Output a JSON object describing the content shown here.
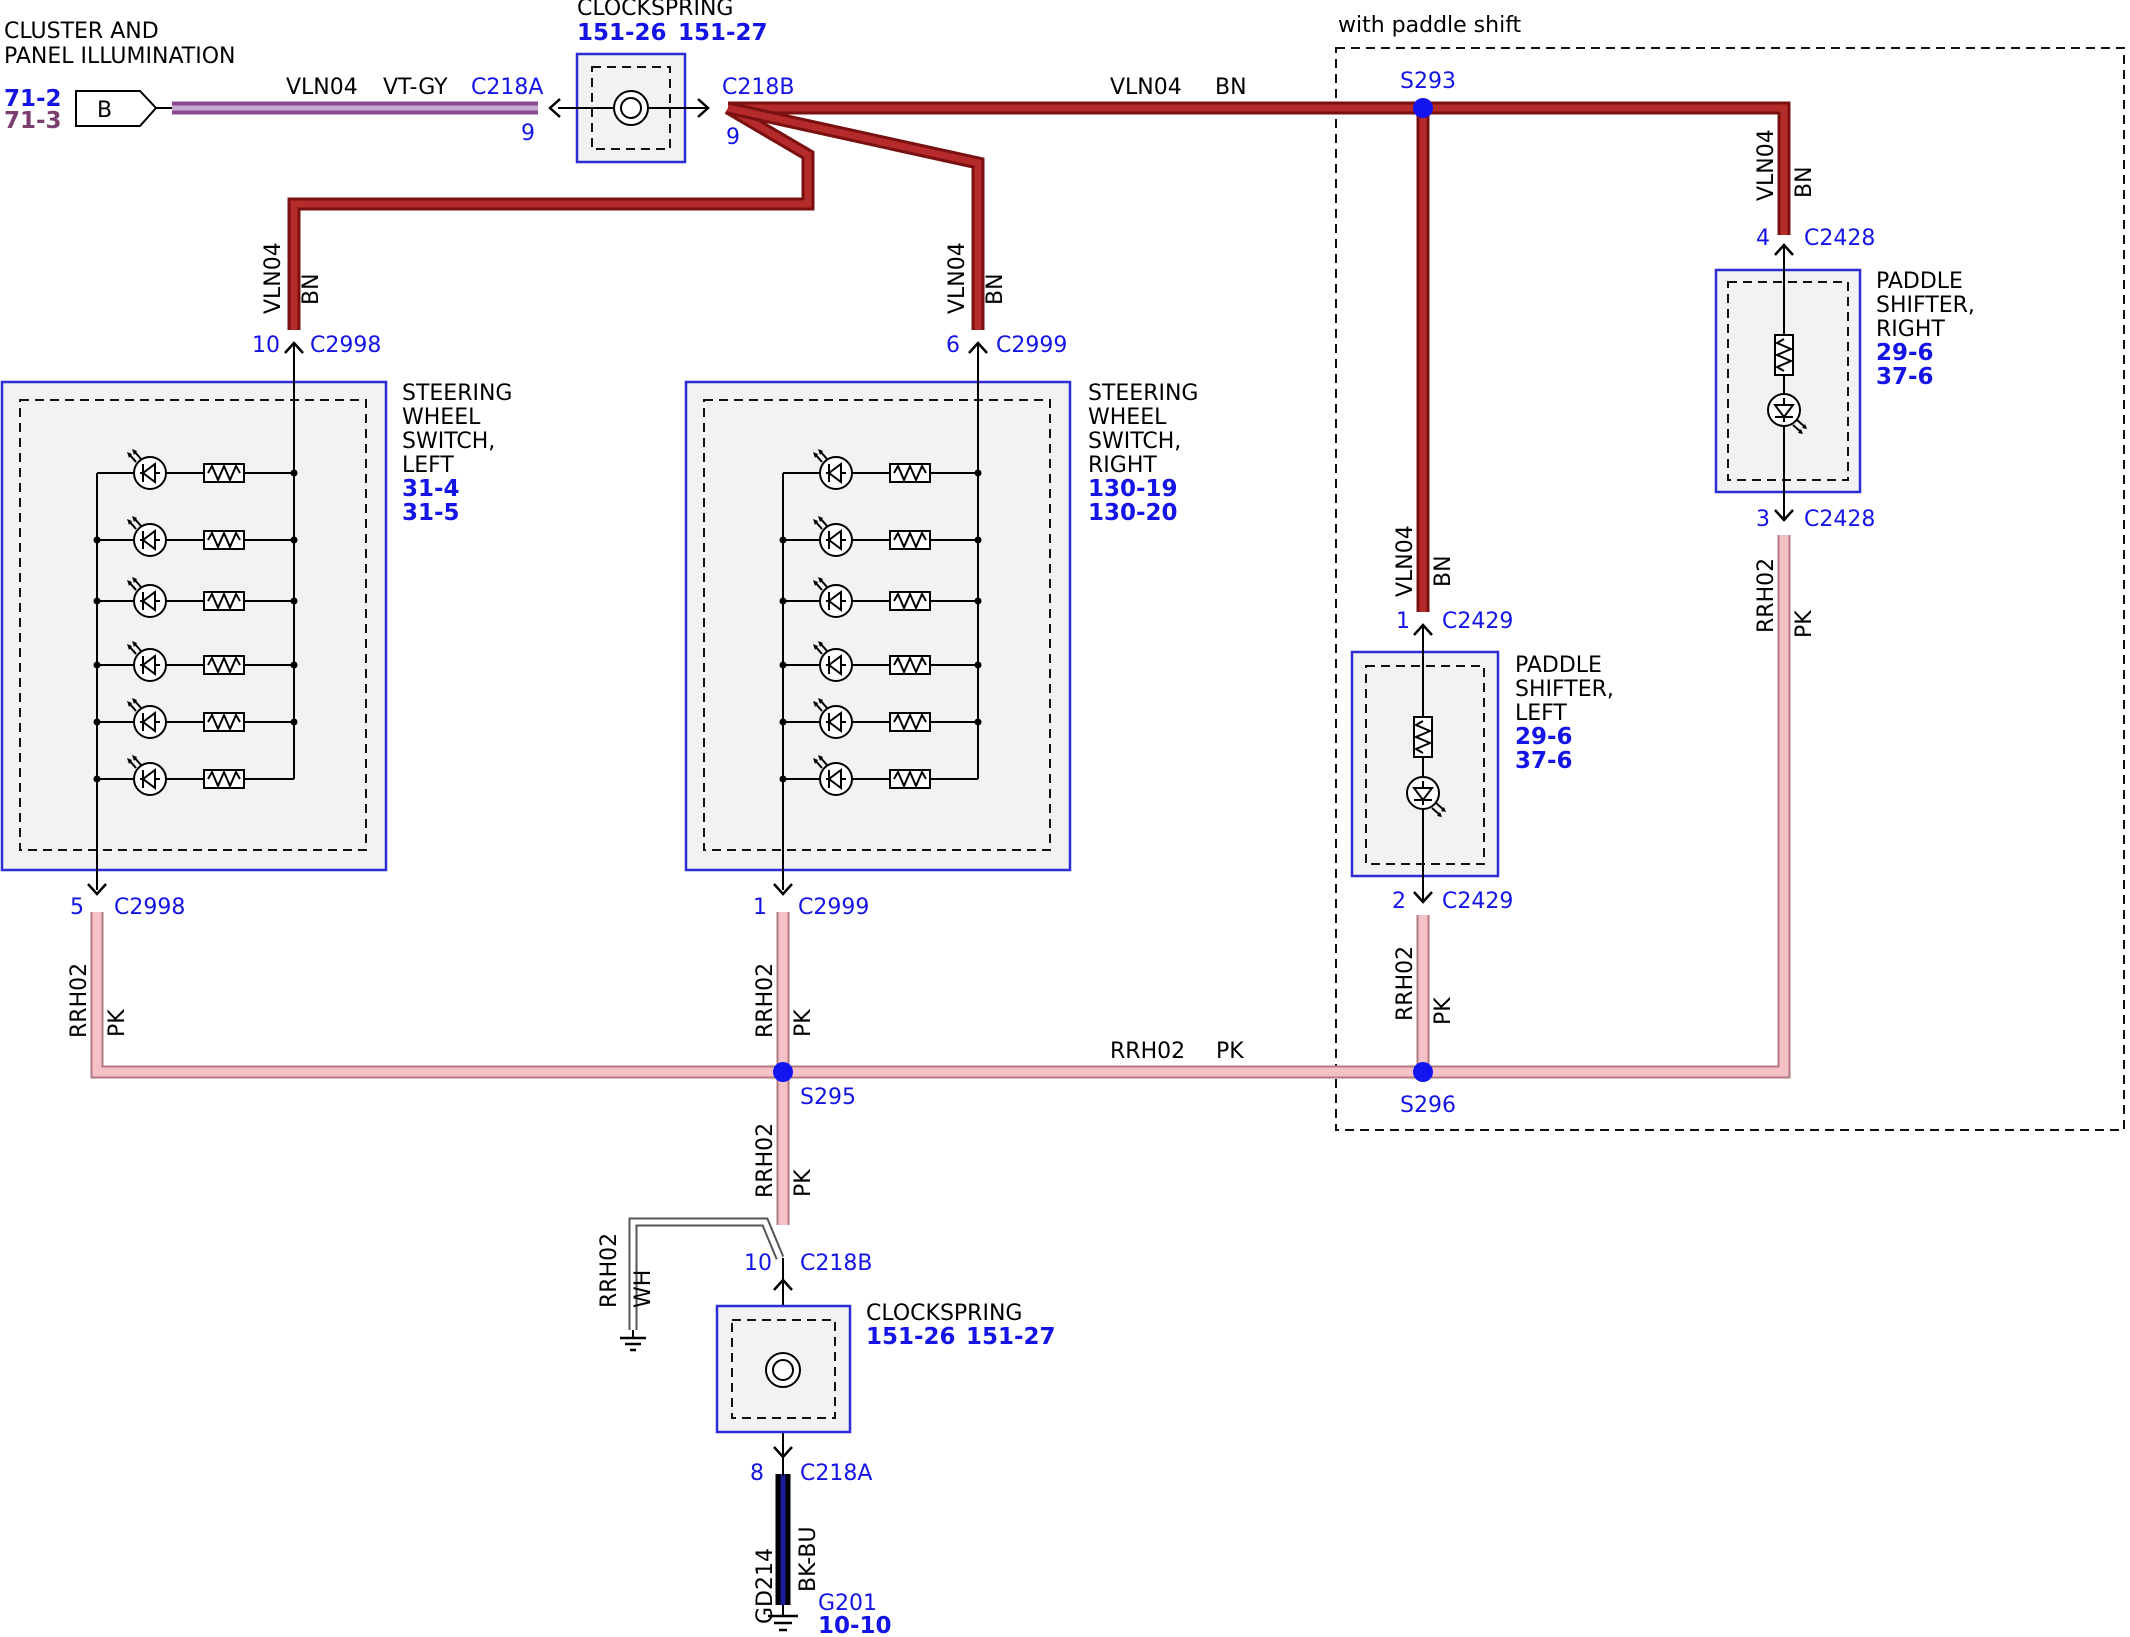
{
  "source": {
    "title_line1": "CLUSTER AND",
    "title_line2": "PANEL ILLUMINATION",
    "ref1": "71-2",
    "ref2": "71-3",
    "connector_letter": "B"
  },
  "clockspring_top": {
    "title": "CLOCKSPRING",
    "ref1": "151-26",
    "ref2": "151-27",
    "left_connector": "C218A",
    "left_pin": "9",
    "right_connector": "C218B",
    "right_pin": "9"
  },
  "clockspring_bottom": {
    "title": "CLOCKSPRING",
    "ref1": "151-26",
    "ref2": "151-27",
    "top_connector": "C218B",
    "top_pin": "10",
    "bottom_connector": "C218A",
    "bottom_pin": "8"
  },
  "paddle_group_label": "with paddle shift",
  "wires": {
    "vln04": "VLN04",
    "bn": "BN",
    "vt_gy": "VT-GY",
    "rrh02": "RRH02",
    "pk": "PK",
    "wh": "WH",
    "gd214": "GD214",
    "bk_bu": "BK-BU"
  },
  "splices": {
    "s293": "S293",
    "s295": "S295",
    "s296": "S296"
  },
  "sw_left": {
    "title1": "STEERING",
    "title2": "WHEEL",
    "title3": "SWITCH,",
    "title4": "LEFT",
    "ref1": "31-4",
    "ref2": "31-5",
    "top_pin": "10",
    "top_connector": "C2998",
    "bottom_pin": "5",
    "bottom_connector": "C2998"
  },
  "sw_right": {
    "title1": "STEERING",
    "title2": "WHEEL",
    "title3": "SWITCH,",
    "title4": "RIGHT",
    "ref1": "130-19",
    "ref2": "130-20",
    "top_pin": "6",
    "top_connector": "C2999",
    "bottom_pin": "1",
    "bottom_connector": "C2999"
  },
  "paddle_left": {
    "title1": "PADDLE",
    "title2": "SHIFTER,",
    "title3": "LEFT",
    "ref1": "29-6",
    "ref2": "37-6",
    "top_pin": "1",
    "top_connector": "C2429",
    "bottom_pin": "2",
    "bottom_connector": "C2429"
  },
  "paddle_right": {
    "title1": "PADDLE",
    "title2": "SHIFTER,",
    "title3": "RIGHT",
    "ref1": "29-6",
    "ref2": "37-6",
    "top_pin": "4",
    "top_connector": "C2428",
    "bottom_pin": "3",
    "bottom_connector": "C2428"
  },
  "ground": {
    "name": "G201",
    "ref": "10-10"
  }
}
